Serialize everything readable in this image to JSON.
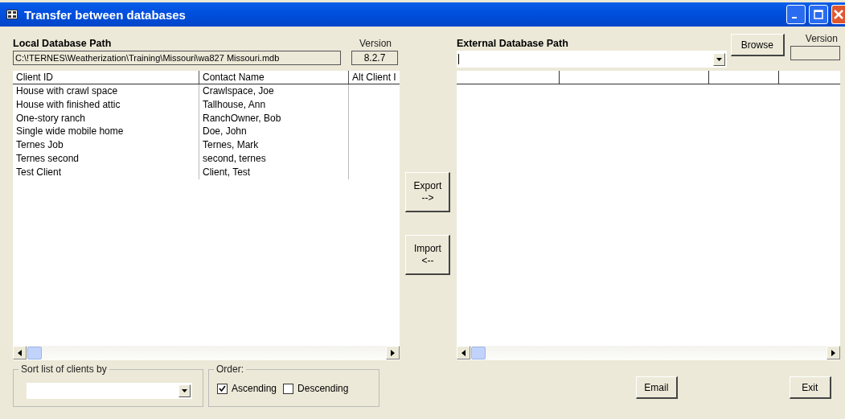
{
  "window": {
    "title": "Transfer between databases"
  },
  "local": {
    "heading": "Local Database Path",
    "version_label": "Version",
    "path": "C:\\!TERNES\\Weatherization\\Training\\Missouri\\wa827 Missouri.mdb",
    "version": "8.2.7",
    "table": {
      "columns": [
        "Client ID",
        "Contact Name",
        "Alt Client I"
      ],
      "rows": [
        [
          "House with crawl space",
          "Crawlspace, Joe",
          ""
        ],
        [
          "House with finished attic",
          "Tallhouse, Ann",
          ""
        ],
        [
          "One-story ranch",
          "RanchOwner, Bob",
          ""
        ],
        [
          "Single wide mobile home",
          "Doe, John",
          ""
        ],
        [
          "Ternes Job",
          "Ternes, Mark",
          ""
        ],
        [
          "Ternes second",
          "second, ternes",
          ""
        ],
        [
          "Test Client",
          "Client, Test",
          ""
        ]
      ]
    }
  },
  "transfer_buttons": [
    {
      "lines": [
        "Export",
        "-->"
      ]
    },
    {
      "lines": [
        "Import",
        "<--"
      ]
    }
  ],
  "external": {
    "heading": "External Database Path",
    "version_label": "Version",
    "browse_button": "Browse"
  },
  "sort": {
    "legend": "Sort list of clients by"
  },
  "order": {
    "legend": "Order:",
    "options": [
      {
        "label": "Ascending",
        "checked": true
      },
      {
        "label": "Descending",
        "checked": false
      }
    ]
  },
  "buttons": [
    "Email",
    "Exit"
  ]
}
